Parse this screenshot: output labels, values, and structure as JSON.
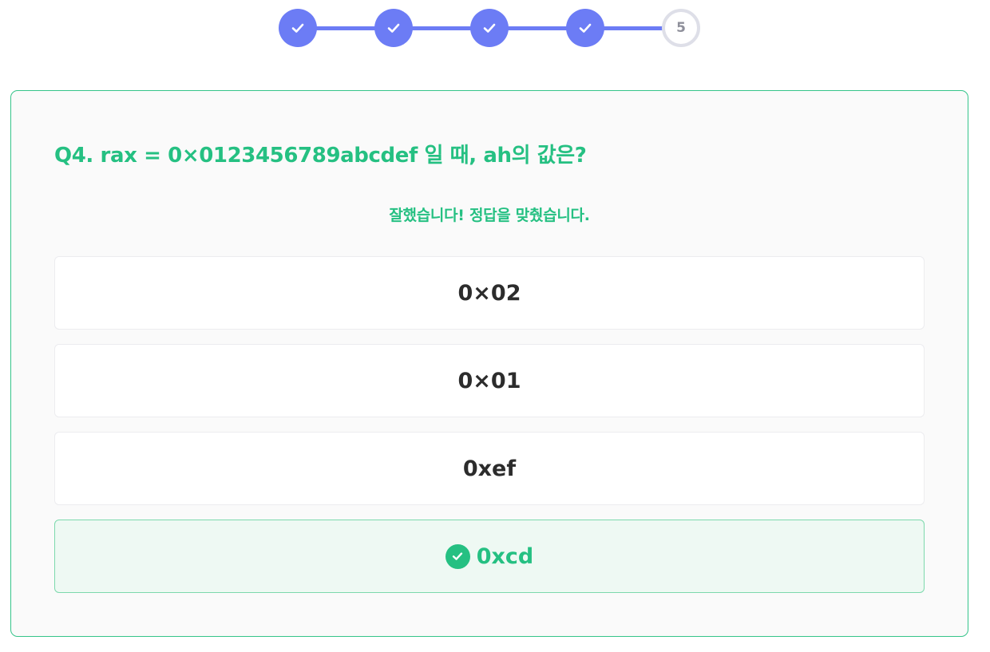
{
  "stepper": {
    "steps": [
      {
        "state": "done",
        "icon": "check-icon"
      },
      {
        "state": "done",
        "icon": "check-icon"
      },
      {
        "state": "done",
        "icon": "check-icon"
      },
      {
        "state": "done",
        "icon": "check-icon"
      },
      {
        "state": "current",
        "label": "5"
      }
    ],
    "accent_color": "#6c7cf5"
  },
  "quiz": {
    "question": "Q4. rax = 0×0123456789abcdef 일 때, ah의 값은?",
    "feedback": "잘했습니다! 정답을 맞췄습니다.",
    "options": [
      {
        "label": "0×02",
        "state": "default"
      },
      {
        "label": "0×01",
        "state": "default"
      },
      {
        "label": "0xef",
        "state": "default"
      },
      {
        "label": "0xcd",
        "state": "correct",
        "icon": "check-circle-icon"
      }
    ],
    "accent_color": "#25c082"
  }
}
